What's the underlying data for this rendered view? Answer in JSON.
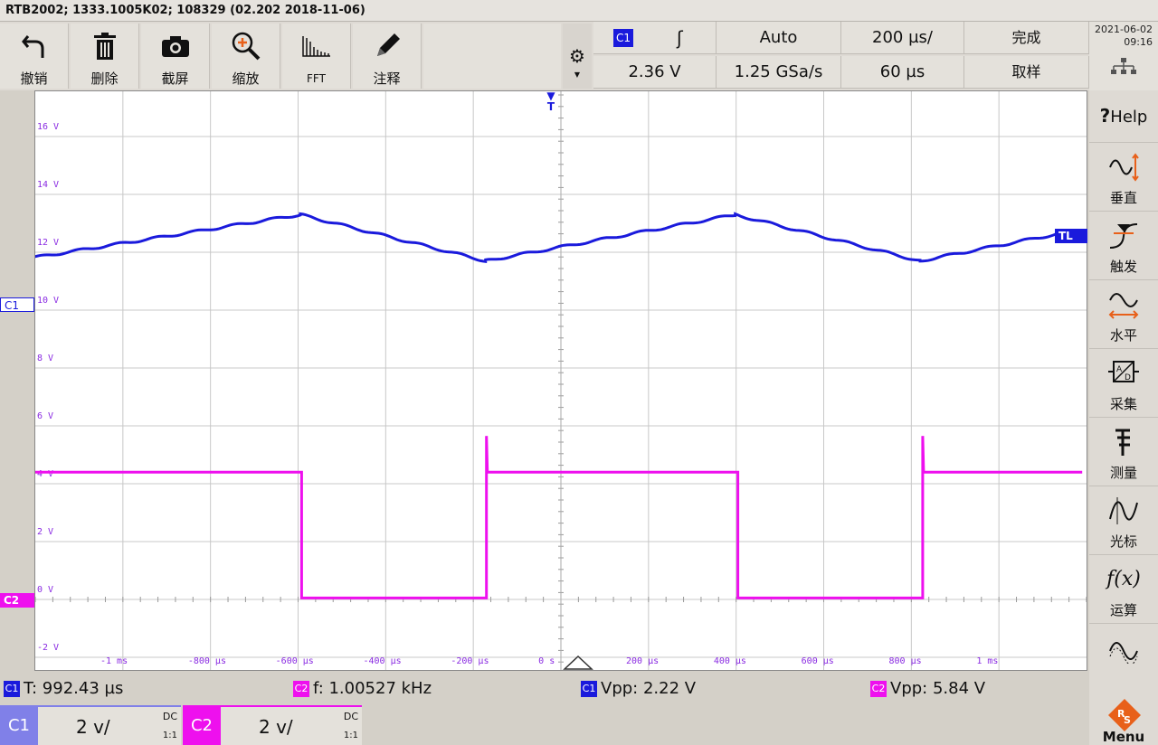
{
  "titlebar": "RTB2002; 1333.1005K02; 108329 (02.202 2018-11-06)",
  "toolbar": {
    "undo": "撤销",
    "delete": "删除",
    "screenshot": "截屏",
    "zoom": "缩放",
    "fft": "FFT",
    "annotate": "注释"
  },
  "trigger": {
    "channel": "C1",
    "slope": "ʃ",
    "mode": "Auto",
    "timebase": "200 µs/",
    "status": "完成",
    "level": "2.36 V",
    "samplerate": "1.25 GSa/s",
    "position": "60 µs",
    "acq": "取样"
  },
  "clock": {
    "date": "2021-06-02",
    "time": "09:16"
  },
  "sidebar": {
    "help": "Help",
    "vertical": "垂直",
    "trigger": "触发",
    "horizontal": "水平",
    "acquire": "采集",
    "measure": "测量",
    "cursor": "光标",
    "math": "运算",
    "more": "参考"
  },
  "y_labels": [
    "16 V",
    "14 V",
    "12 V",
    "10 V",
    "8 V",
    "6 V",
    "4 V",
    "2 V",
    "0 V",
    "-2 V"
  ],
  "x_labels": [
    "-1 ms",
    "-800 µs",
    "-600 µs",
    "-400 µs",
    "-200 µs",
    "0 s",
    "200 µs",
    "400 µs",
    "600 µs",
    "800 µs",
    "1 ms"
  ],
  "markers": {
    "c1": "C1",
    "c2": "C2",
    "trig": "T",
    "tl": "TL"
  },
  "measurements": {
    "m1_ch": "C1",
    "m1": "T: 992.43 µs",
    "m2_ch": "C2",
    "m2": "f: 1.00527 kHz",
    "m3_ch": "C1",
    "m3": "Vpp: 2.22 V",
    "m4_ch": "C2",
    "m4": "Vpp: 5.84 V"
  },
  "channels": {
    "c1": {
      "label": "C1",
      "scale": "2 v/",
      "coupling": "DC",
      "probe": "1:1"
    },
    "c2": {
      "label": "C2",
      "scale": "2 v/",
      "coupling": "DC",
      "probe": "1:1"
    }
  },
  "menu": "Menu",
  "colors": {
    "c1": "#1a1adc",
    "c2": "#ee10ee",
    "grid": "#c8c8c8"
  }
}
